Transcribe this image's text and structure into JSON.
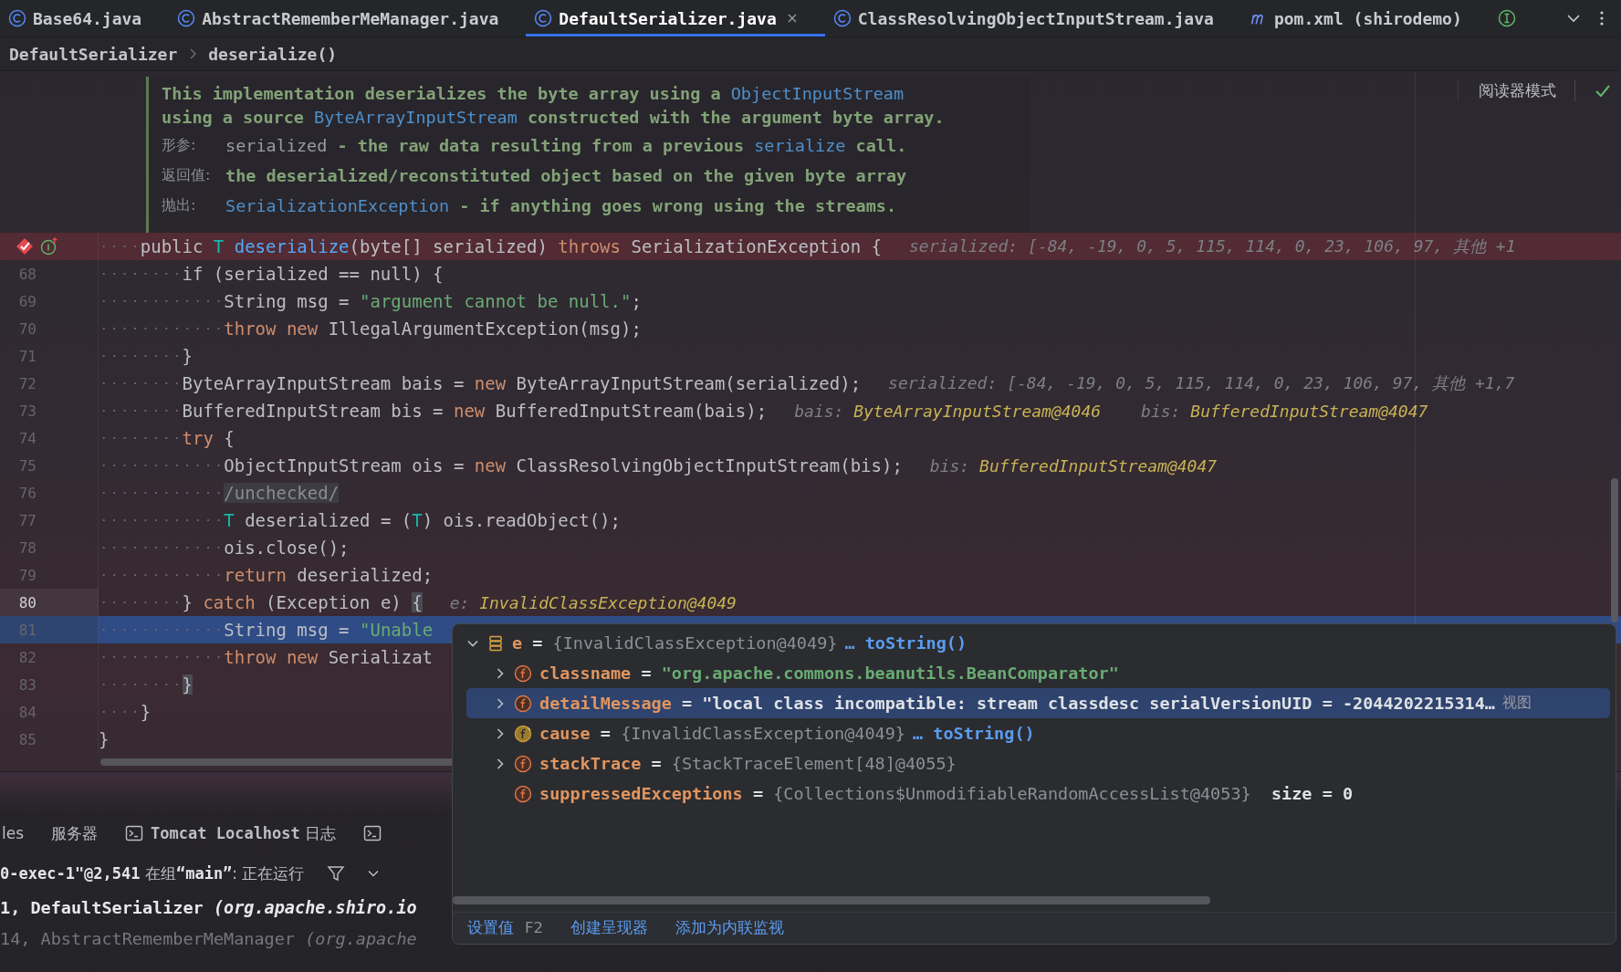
{
  "tabs": [
    {
      "label": "Base64.java",
      "kind": "class",
      "selected": false,
      "closable": false
    },
    {
      "label": "AbstractRememberMeManager.java",
      "kind": "class",
      "selected": false,
      "closable": false
    },
    {
      "label": "DefaultSerializer.java",
      "kind": "class",
      "selected": true,
      "closable": true
    },
    {
      "label": "ClassResolvingObjectInputStream.java",
      "kind": "class",
      "selected": false,
      "closable": false
    },
    {
      "label": "pom.xml (shirodemo)",
      "kind": "maven",
      "selected": false,
      "closable": false
    },
    {
      "kind": "interface",
      "selected": false,
      "closable": false
    }
  ],
  "breadcrumbs": [
    "DefaultSerializer",
    "deserialize()"
  ],
  "reader_mode": {
    "label": "阅读器模式"
  },
  "doc_comment": {
    "summary": [
      [
        {
          "kind": "text",
          "text": "This implementation deserializes the byte array using a "
        },
        {
          "kind": "link",
          "text": "ObjectInputStream"
        }
      ],
      [
        {
          "kind": "text",
          "text": "using a source "
        },
        {
          "kind": "link",
          "text": "ByteArrayInputStream"
        },
        {
          "kind": "text",
          "text": " constructed with the argument byte array."
        }
      ]
    ],
    "tags": [
      {
        "label": "形参:",
        "segments": [
          {
            "kind": "param",
            "text": "serialized"
          },
          {
            "kind": "text",
            "text": " - the raw data resulting from a previous "
          },
          {
            "kind": "link",
            "text": "serialize"
          },
          {
            "kind": "text",
            "text": " call."
          }
        ]
      },
      {
        "label": "返回值:",
        "segments": [
          {
            "kind": "text",
            "text": "the deserialized/reconstituted object based on the given byte array"
          }
        ]
      },
      {
        "label": "抛出:",
        "segments": [
          {
            "kind": "link",
            "text": "SerializationException"
          },
          {
            "kind": "text",
            "text": " - if anything goes wrong using the streams."
          }
        ]
      }
    ]
  },
  "code_lines": [
    {
      "breakpoint": true,
      "execution": false,
      "caret": false,
      "tokens": [
        {
          "kind": "plain",
          "text": "    public "
        },
        {
          "kind": "typeparam",
          "text": "T "
        },
        {
          "kind": "function",
          "text": "deserialize"
        },
        {
          "kind": "plain",
          "text": "(byte[] serialized) "
        },
        {
          "kind": "keyword",
          "text": "throws"
        },
        {
          "kind": "plain",
          "text": " SerializationException {"
        }
      ],
      "hints": [
        {
          "name": "serialized:",
          "value": "[-84, -19, 0, 5, 115, 114, 0, 23, 106, 97, 其他 +1",
          "kind": "array"
        }
      ]
    },
    {
      "number": "68",
      "breakpoint": false,
      "execution": false,
      "caret": false,
      "tokens": [
        {
          "kind": "plain",
          "text": "        if (serialized == null) {"
        }
      ]
    },
    {
      "number": "69",
      "breakpoint": false,
      "execution": false,
      "caret": false,
      "tokens": [
        {
          "kind": "plain",
          "text": "            String msg = "
        },
        {
          "kind": "string",
          "text": "\"argument cannot be null.\""
        },
        {
          "kind": "plain",
          "text": ";"
        }
      ]
    },
    {
      "number": "70",
      "breakpoint": false,
      "execution": false,
      "caret": false,
      "tokens": [
        {
          "kind": "keyword",
          "text": "            throw new"
        },
        {
          "kind": "plain",
          "text": " IllegalArgumentException(msg);"
        }
      ]
    },
    {
      "number": "71",
      "breakpoint": false,
      "execution": false,
      "caret": false,
      "tokens": [
        {
          "kind": "plain",
          "text": "        }"
        }
      ]
    },
    {
      "number": "72",
      "breakpoint": false,
      "execution": false,
      "caret": false,
      "tokens": [
        {
          "kind": "plain",
          "text": "        ByteArrayInputStream bais = "
        },
        {
          "kind": "keyword",
          "text": "new"
        },
        {
          "kind": "plain",
          "text": " ByteArrayInputStream(serialized);"
        }
      ],
      "hints": [
        {
          "name": "serialized:",
          "value": "[-84, -19, 0, 5, 115, 114, 0, 23, 106, 97, 其他 +1,7",
          "kind": "array"
        }
      ]
    },
    {
      "number": "73",
      "breakpoint": false,
      "execution": false,
      "caret": false,
      "tokens": [
        {
          "kind": "plain",
          "text": "        BufferedInputStream bis = "
        },
        {
          "kind": "keyword",
          "text": "new"
        },
        {
          "kind": "plain",
          "text": " BufferedInputStream(bais);"
        }
      ],
      "hints": [
        {
          "name": "bais:",
          "value": "ByteArrayInputStream@4046",
          "kind": "ref"
        },
        {
          "name": "bis:",
          "value": "BufferedInputStream@4047",
          "kind": "ref"
        }
      ]
    },
    {
      "number": "74",
      "breakpoint": false,
      "execution": false,
      "caret": false,
      "tokens": [
        {
          "kind": "keyword",
          "text": "        try"
        },
        {
          "kind": "plain",
          "text": " {"
        }
      ]
    },
    {
      "number": "75",
      "breakpoint": false,
      "execution": false,
      "caret": false,
      "tokens": [
        {
          "kind": "plain",
          "text": "            ObjectInputStream ois = "
        },
        {
          "kind": "keyword",
          "text": "new"
        },
        {
          "kind": "plain",
          "text": " ClassResolvingObjectInputStream(bis);"
        }
      ],
      "hints": [
        {
          "name": "bis:",
          "value": "BufferedInputStream@4047",
          "kind": "ref"
        }
      ]
    },
    {
      "number": "76",
      "breakpoint": false,
      "execution": false,
      "caret": false,
      "tokens": [
        {
          "kind": "folded",
          "text": "            /unchecked/"
        }
      ]
    },
    {
      "number": "77",
      "breakpoint": false,
      "execution": false,
      "caret": false,
      "tokens": [
        {
          "kind": "typeparam",
          "text": "            T"
        },
        {
          "kind": "plain",
          "text": " deserialized = ("
        },
        {
          "kind": "typeparam",
          "text": "T"
        },
        {
          "kind": "plain",
          "text": ") ois.readObject();"
        }
      ]
    },
    {
      "number": "78",
      "breakpoint": false,
      "execution": false,
      "caret": false,
      "tokens": [
        {
          "kind": "plain",
          "text": "            ois.close();"
        }
      ]
    },
    {
      "number": "79",
      "breakpoint": false,
      "execution": false,
      "caret": false,
      "tokens": [
        {
          "kind": "keyword",
          "text": "            return"
        },
        {
          "kind": "plain",
          "text": " deserialized;"
        }
      ]
    },
    {
      "number": "80",
      "breakpoint": false,
      "execution": false,
      "caret": true,
      "tokens": [
        {
          "kind": "plain",
          "text": "        } "
        },
        {
          "kind": "keyword",
          "text": "catch"
        },
        {
          "kind": "plain",
          "text": " (Exception e) "
        },
        {
          "kind": "brace",
          "text": "{"
        }
      ],
      "hints": [
        {
          "name": "e:",
          "value": "InvalidClassException@4049",
          "kind": "ref"
        }
      ]
    },
    {
      "number": "81",
      "breakpoint": false,
      "execution": true,
      "caret": false,
      "tokens": [
        {
          "kind": "plain",
          "text": "            String msg = "
        },
        {
          "kind": "string",
          "text": "\"Unable"
        }
      ]
    },
    {
      "number": "82",
      "breakpoint": false,
      "execution": false,
      "caret": false,
      "tokens": [
        {
          "kind": "keyword",
          "text": "            throw new"
        },
        {
          "kind": "plain",
          "text": " Serializat"
        }
      ]
    },
    {
      "number": "83",
      "breakpoint": false,
      "execution": false,
      "caret": false,
      "tokens": [
        {
          "kind": "brace",
          "text": "        }"
        }
      ]
    },
    {
      "number": "84",
      "breakpoint": false,
      "execution": false,
      "caret": false,
      "tokens": [
        {
          "kind": "plain",
          "text": "    }"
        }
      ]
    },
    {
      "number": "85",
      "breakpoint": false,
      "execution": false,
      "caret": false,
      "tokens": [
        {
          "kind": "plain",
          "text": "}"
        }
      ]
    }
  ],
  "debug_panel": {
    "tabs": [
      {
        "kind": "text",
        "label": "les"
      },
      {
        "kind": "text",
        "label": "服务器"
      },
      {
        "kind": "console",
        "label": "**Tomcat Localhost** 日志"
      },
      {
        "kind": "console"
      }
    ],
    "thread": "**0-exec-1\"@2,541** 在组**“main”**: 正在运行",
    "frames": [
      {
        "text": "1, DefaultSerializer *(org.apache.shiro.io*",
        "selected": true
      },
      {
        "text": "14, AbstractRememberMeManager *(org.apache*",
        "selected": false
      }
    ]
  },
  "value_popup": {
    "tree": [
      {
        "name": "e",
        "operator": "=",
        "kind": "variable",
        "has_children": true,
        "expanded": true,
        "selected": false,
        "value": [
          {
            "kind": "type",
            "text": "{InvalidClassException@4049}"
          },
          {
            "kind": "link",
            "text": "… toString()"
          }
        ],
        "children": [
          {
            "name": "classname",
            "operator": "=",
            "kind": "field",
            "has_children": true,
            "expanded": false,
            "selected": false,
            "value": [
              {
                "kind": "string",
                "text": "\"org.apache.commons.beanutils.BeanComparator\""
              }
            ]
          },
          {
            "name": "detailMessage",
            "operator": "=",
            "kind": "field",
            "has_children": true,
            "expanded": false,
            "selected": true,
            "value": [
              {
                "kind": "text",
                "text": "\"local class incompatible: stream classdesc serialVersionUID = -2044202215314…"
              },
              {
                "kind": "action",
                "text": "视图"
              }
            ]
          },
          {
            "name": "cause",
            "operator": "=",
            "kind": "self-field",
            "has_children": true,
            "expanded": false,
            "selected": false,
            "value": [
              {
                "kind": "type",
                "text": "{InvalidClassException@4049}"
              },
              {
                "kind": "link",
                "text": "… toString()"
              }
            ]
          },
          {
            "name": "stackTrace",
            "operator": "=",
            "kind": "field",
            "has_children": true,
            "expanded": false,
            "selected": false,
            "value": [
              {
                "kind": "type",
                "text": "{StackTraceElement[48]@4055}"
              }
            ]
          },
          {
            "name": "suppressedExceptions",
            "operator": "=",
            "kind": "field",
            "has_children": false,
            "selected": false,
            "value": [
              {
                "kind": "type",
                "text": "{Collections$UnmodifiableRandomAccessList@4053}"
              },
              {
                "kind": "text",
                "text": "  size = 0"
              }
            ]
          }
        ]
      }
    ],
    "actions": [
      {
        "label": "设置值",
        "shortcut": "F2"
      },
      {
        "label": "创建呈现器"
      },
      {
        "label": "添加为内联监视"
      }
    ]
  }
}
